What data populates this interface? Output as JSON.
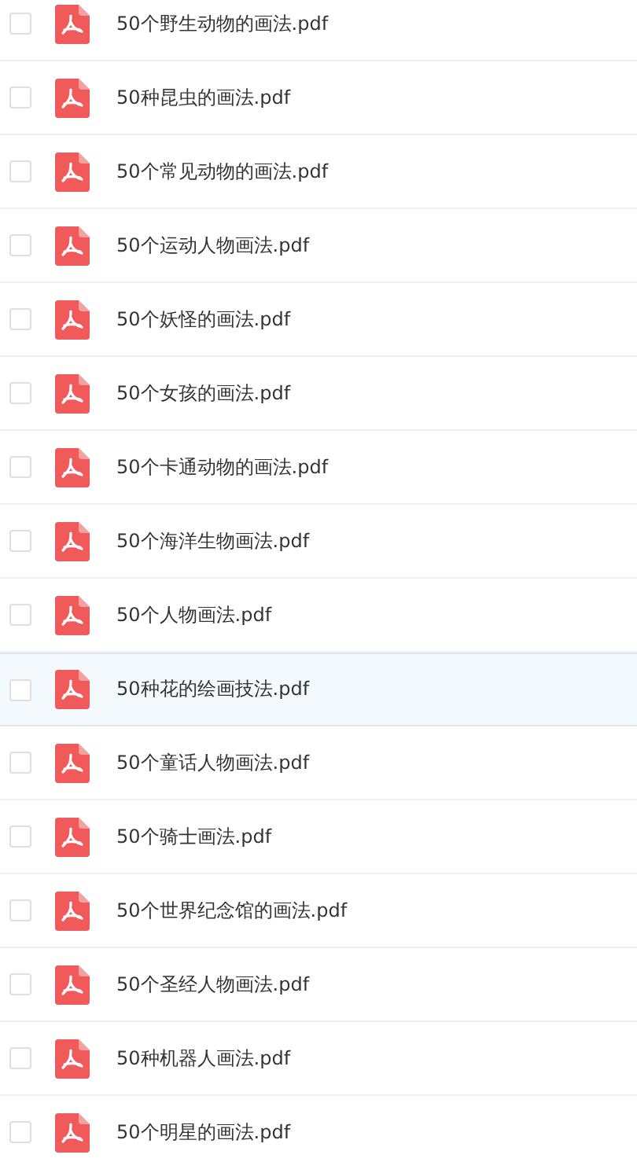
{
  "files": [
    {
      "name": "50个野生动物的画法.pdf",
      "checked": false,
      "selected": false
    },
    {
      "name": "50种昆虫的画法.pdf",
      "checked": false,
      "selected": false
    },
    {
      "name": "50个常见动物的画法.pdf",
      "checked": false,
      "selected": false
    },
    {
      "name": "50个运动人物画法.pdf",
      "checked": false,
      "selected": false
    },
    {
      "name": "50个妖怪的画法.pdf",
      "checked": false,
      "selected": false
    },
    {
      "name": "50个女孩的画法.pdf",
      "checked": false,
      "selected": false
    },
    {
      "name": "50个卡通动物的画法.pdf",
      "checked": false,
      "selected": false
    },
    {
      "name": "50个海洋生物画法.pdf",
      "checked": false,
      "selected": false
    },
    {
      "name": "50个人物画法.pdf",
      "checked": false,
      "selected": false
    },
    {
      "name": "50种花的绘画技法.pdf",
      "checked": false,
      "selected": true
    },
    {
      "name": "50个童话人物画法.pdf",
      "checked": false,
      "selected": false
    },
    {
      "name": "50个骑士画法.pdf",
      "checked": false,
      "selected": false
    },
    {
      "name": "50个世界纪念馆的画法.pdf",
      "checked": false,
      "selected": false
    },
    {
      "name": "50个圣经人物画法.pdf",
      "checked": false,
      "selected": false
    },
    {
      "name": "50种机器人画法.pdf",
      "checked": false,
      "selected": false
    },
    {
      "name": "50个明星的画法.pdf",
      "checked": false,
      "selected": false
    }
  ]
}
